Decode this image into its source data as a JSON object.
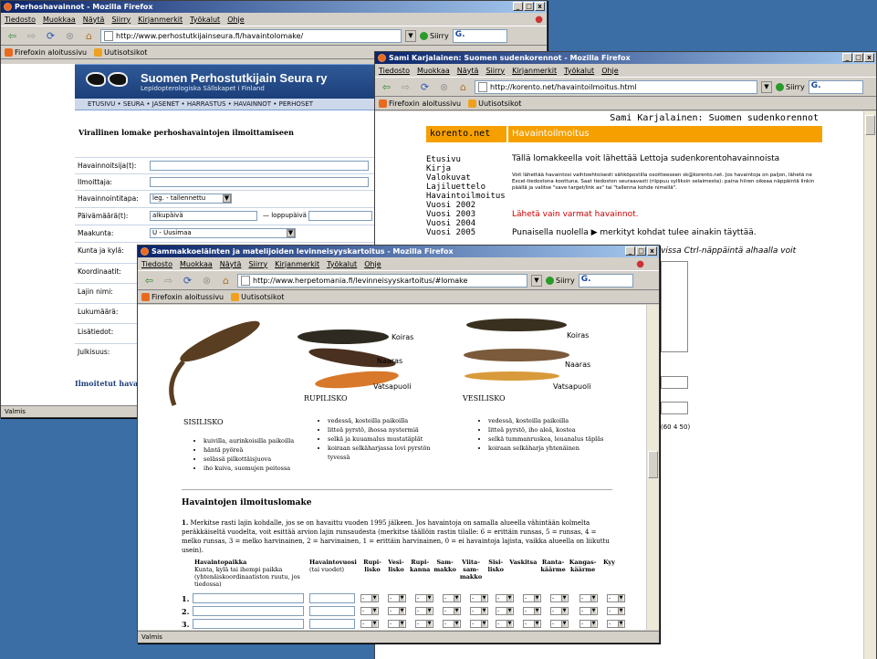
{
  "menu": [
    "Tiedosto",
    "Muokkaa",
    "Näytä",
    "Siirry",
    "Kirjanmerkit",
    "Työkalut",
    "Ohje"
  ],
  "go_label": "Siirry",
  "search_text": "G.",
  "bookmarks": {
    "b1": "Firefoxin aloitussivu",
    "b2": "Uutisotsikot"
  },
  "status_text": "Valmis",
  "w1": {
    "title": "Perhoshavainnot - Mozilla Firefox",
    "url": "http://www.perhostutkijainseura.fi/havaintolomake/",
    "site_title": "Suomen Perhostutkijain Seura ry",
    "site_subtitle": "Lepidopterologiska Sällskapet i Finland",
    "nav": "ETUSIVU  •  SEURA  •  JASENET  •  HARRASTUS  •  HAVAINNOT  •  PERHOSET",
    "form_heading": "Virallinen lomake perhoshavaintojen ilmoittamiseen",
    "labels": [
      "Havainnoitsija(t):",
      "Ilmoittaja:",
      "Havainnointitapa:",
      "Päivämäärä(t):",
      "Maakunta:",
      "Kunta ja kylä:",
      "Koordinaatit:",
      "Lajin nimi:",
      "Lukumäärä:",
      "Lisätiedot:",
      "Julkisuus:"
    ],
    "method_value": "leg. - tallennettu",
    "start_date": "alkupäivä",
    "end_date": "— loppupäivä",
    "province": "U - Uusimaa",
    "reported": "Ilmoitetut havai"
  },
  "w2": {
    "title": "Sami Karjalainen: Suomen sudenkorennot - Mozilla Firefox",
    "url": "http://korento.net/havaintoilmoitus.html",
    "header": "Sami Karjalainen: Suomen sudenkorennot",
    "brand": "korento.net",
    "section": "Havaintoilmoitus",
    "nav": [
      "Etusivu",
      "Kirja",
      "Valokuvat",
      "Lajiluettelo",
      "Havaintoilmoitus",
      "Vuosi 2002",
      "Vuosi 2003",
      "Vuosi 2004",
      "Vuosi 2005"
    ],
    "intro": "Tällä lomakkeella voit lähettää Lettoja sudenkorentohavainnoista",
    "small": "Voit lähettää havaintosi vaihtoehtoisesti sähköpostilla osoitteeseen sk@korento.net. Jos havaintoja on paljon, lähetä ne Excel-tiedostona koottuna. Saat tiedoston seuraavasti (riippuu sylliksin selaimesta): paina hiiren oikeaa näppäintä linkin päällä ja valitse \"save target/link as\" tai \"tallenna kohde nimellä\".",
    "send_note": "Lähetä vain varmat havainnot.",
    "arrow_note": "Punaisella nuolella ▶ merkityt kohdat tulee ainakin täyttää.",
    "ctrl_note": "vissa Ctrl-näppäintä alhaalla voit",
    "coord_note": "(60 4  50)"
  },
  "w3": {
    "title": "Sammakkoeläinten ja matelijoiden levinneisyyskartoitus - Mozilla Firefox",
    "url": "http://www.herpetomania.fi/levinneisyyskartoitus/#lomake",
    "cap_koiras": "Koiras",
    "cap_naaras": "Naaras",
    "cap_vatsa": "Vatsapuoli",
    "cap_koiras2": "Koiras",
    "cap_naaras2": "Naaras",
    "cap_vatsa2": "Vatsapuoli",
    "sisilisko": "SISILISKO",
    "rupilisko": "RUPILISKO",
    "vesilisko": "VESILISKO",
    "sisi_list": [
      "kuivilla, aurinkoisilla paikoilla",
      "häntä pyöreä",
      "selässä pilkottäisjuova",
      "iho kuiva, suomujen peitossa"
    ],
    "rupi_list": [
      "vedessä, kosteilla paikoilla",
      "litteä pyrstö, ihossa nystermiä",
      "selkä ja kuuamalus mustatäplät",
      "koiraan selkäharjassa lovi pyrstön tyvessä"
    ],
    "vesi_list": [
      "vedessä, kosteilla paikoilla",
      "litteä pyrstö, iho aleä, kostea",
      "selkä tummanruskea, leuanalus täpläs",
      "koiraan selkäharja yhtenäinen"
    ],
    "form_title": "Havaintojen ilmoituslomake",
    "para_num": "1.",
    "para": "Merkitse rasti lajin kohdalle, jos se on havaittu vuoden 1995 jälkeen. Jos havaintoja on samalla alueella vähintään kolmelta peräkkäiseltä vuodelta, voit esittää arvion lajin runsaudesta (merkitse täällöin rastin tilalle: 6 = erittäin runsas, 5 = runsas, 4 = melko runsas, 3 = melko harvinainen, 2 = harvinainen, 1 = erittäin harvinainen, 0 = ei havaintoja lajista, vaikka alueella on liikuttu usein).",
    "col_place": "Havaintopaikka",
    "col_place_sub": "Kunta, kylä tai ihempi paikka (yhtenäiskoordinaatiston ruutu, jos tiedossa)",
    "col_year": "Havaintovuosi",
    "col_year_sub": "(tai vuodet)",
    "cols": [
      "Rupi-lisko",
      "Vesi-lisko",
      "Rupi-kanna",
      "Sam-makko",
      "Viita-sam-makko",
      "Sisi-lisko",
      "Vaskitsa",
      "Ranta-käärme",
      "Kangas-käärme",
      "Kyy"
    ],
    "rows": [
      "1.",
      "2.",
      "3."
    ],
    "sel": "-"
  }
}
